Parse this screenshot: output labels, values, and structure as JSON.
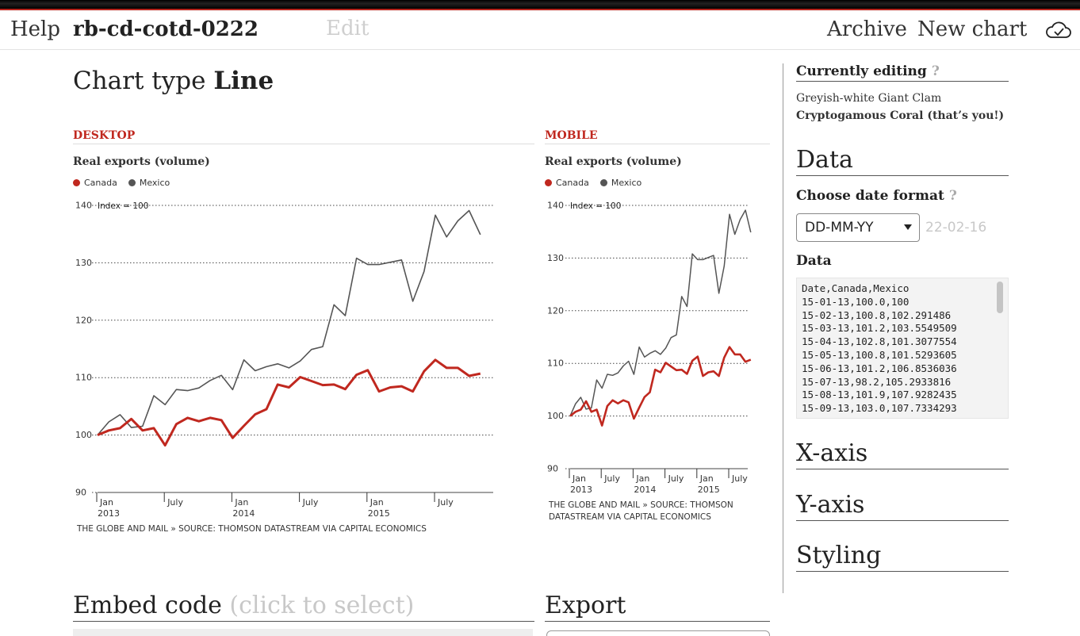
{
  "nav": {
    "help": "Help",
    "slug": "rb-cd-cotd-0222",
    "edit": "Edit",
    "archive": "Archive",
    "new_chart": "New chart",
    "cloud_icon": "cloud-check-icon"
  },
  "chart_type": {
    "label": "Chart type",
    "value": "Line"
  },
  "desktop": {
    "section": "DESKTOP",
    "title": "Real exports (volume)",
    "legend": [
      "Canada",
      "Mexico"
    ],
    "index_label": "Index = 100",
    "source": "THE GLOBE AND MAIL » SOURCE: THOMSON DATASTREAM VIA CAPITAL ECONOMICS"
  },
  "mobile": {
    "section": "MOBILE",
    "title": "Real exports (volume)",
    "legend": [
      "Canada",
      "Mexico"
    ],
    "index_label": "Index = 100",
    "source_line1": "THE GLOBE AND MAIL » SOURCE: THOMSON",
    "source_line2": "DATASTREAM VIA CAPITAL ECONOMICS"
  },
  "chart_data": {
    "type": "line",
    "title": "Real exports (volume)",
    "x": [
      "2013-01",
      "2013-02",
      "2013-03",
      "2013-04",
      "2013-05",
      "2013-06",
      "2013-07",
      "2013-08",
      "2013-09",
      "2013-10",
      "2013-11",
      "2013-12",
      "2014-01",
      "2014-02",
      "2014-03",
      "2014-04",
      "2014-05",
      "2014-06",
      "2014-07",
      "2014-08",
      "2014-09",
      "2014-10",
      "2014-11",
      "2014-12",
      "2015-01",
      "2015-02",
      "2015-03",
      "2015-04",
      "2015-05",
      "2015-06",
      "2015-07",
      "2015-08",
      "2015-09",
      "2015-10",
      "2015-11"
    ],
    "series": [
      {
        "name": "Canada",
        "color": "#c0281f",
        "values": [
          100.0,
          100.8,
          101.2,
          102.8,
          100.8,
          101.2,
          98.2,
          101.9,
          103.0,
          102.4,
          103.0,
          102.6,
          99.5,
          101.6,
          103.6,
          104.5,
          108.8,
          108.3,
          110.1,
          109.4,
          108.7,
          108.8,
          108.0,
          110.5,
          111.3,
          107.6,
          108.3,
          108.5,
          107.6,
          111.1,
          113.1,
          111.7,
          111.7,
          110.3,
          110.7,
          114.2
        ]
      },
      {
        "name": "Mexico",
        "color": "#555555",
        "values": [
          100,
          102.291486,
          103.5549509,
          101.3077554,
          101.5293605,
          106.8536036,
          105.2933816,
          107.9282435,
          107.7334293,
          108.2,
          109.5,
          110.4,
          107.9,
          113.1,
          111.2,
          111.9,
          112.4,
          111.7,
          112.9,
          114.9,
          115.4,
          122.7,
          120.8,
          130.8,
          129.7,
          129.7,
          130.1,
          130.5,
          123.3,
          128.5,
          138.3,
          134.5,
          137.3,
          139.1,
          134.9,
          137.4
        ]
      }
    ],
    "ylim": [
      90,
      140
    ],
    "yticks": [
      "90",
      "100",
      "110",
      "120",
      "130",
      "140"
    ],
    "xtick_labels": [
      {
        "month": "Jan",
        "year": "2013"
      },
      {
        "month": "July",
        "year": ""
      },
      {
        "month": "Jan",
        "year": "2014"
      },
      {
        "month": "July",
        "year": ""
      },
      {
        "month": "Jan",
        "year": "2015"
      },
      {
        "month": "July",
        "year": ""
      }
    ],
    "annotation": "Index = 100",
    "grid": true,
    "legend_position": "top-left"
  },
  "sidebar": {
    "currently_editing": "Currently editing",
    "help_mark": "?",
    "editors": [
      "Greyish-white Giant Clam",
      "Cryptogamous Coral (that’s you!)"
    ],
    "data_heading": "Data",
    "date_format_label": "Choose date format",
    "date_format_value": "DD-MM-YY",
    "date_format_sample": "22-02-16",
    "data_label": "Data",
    "data_rows": [
      "Date,Canada,Mexico",
      "15-01-13,100.0,100",
      "15-02-13,100.8,102.291486",
      "15-03-13,101.2,103.5549509",
      "15-04-13,102.8,101.3077554",
      "15-05-13,100.8,101.5293605",
      "15-06-13,101.2,106.8536036",
      "15-07-13,98.2,105.2933816",
      "15-08-13,101.9,107.9282435",
      "15-09-13,103.0,107.7334293"
    ],
    "x_axis": "X-axis",
    "y_axis": "Y-axis",
    "styling": "Styling"
  },
  "embed": {
    "label": "Embed code",
    "hint": "(click to select)"
  },
  "export": {
    "label": "Export"
  }
}
